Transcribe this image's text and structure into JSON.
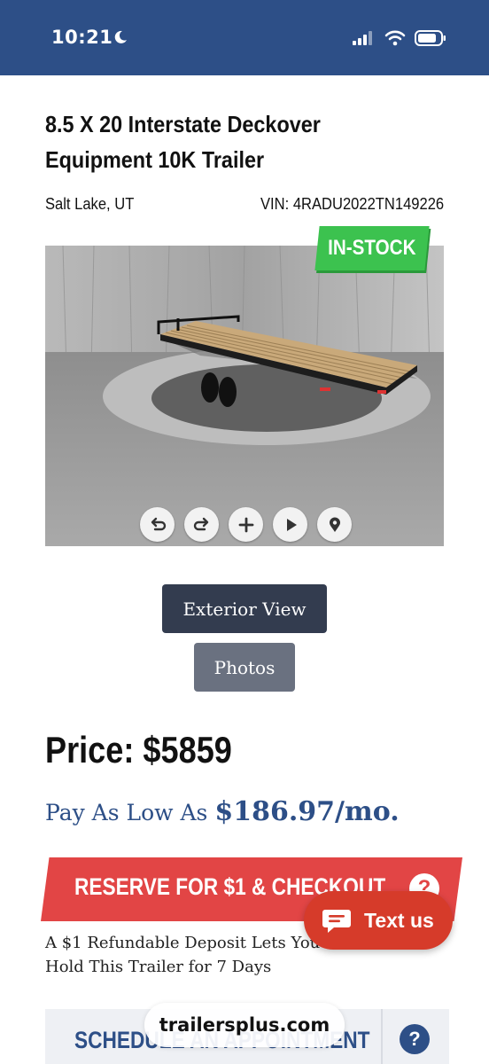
{
  "status_bar": {
    "time": "10:21",
    "icons": [
      "moon-icon",
      "signal-icon",
      "wifi-icon",
      "battery-icon"
    ],
    "color": "#2d4f87"
  },
  "listing": {
    "title": "8.5 X 20 Interstate Deckover Equipment 10K Trailer",
    "location": "Salt Lake, UT",
    "vin": "VIN: 4RADU2022TN149226",
    "stock_badge": "IN-STOCK",
    "stock_badge_color": "#3cc24f"
  },
  "viewer_controls": [
    "rotate-left-icon",
    "rotate-right-icon",
    "zoom-plus-icon",
    "play-icon",
    "location-pin-icon"
  ],
  "view_buttons": {
    "exterior": "Exterior View",
    "photos": "Photos"
  },
  "pricing": {
    "price": "Price: $5859",
    "pay_prefix": "Pay As Low As ",
    "pay_amount": "$186.97/mo."
  },
  "reserve": {
    "label": "RESERVE FOR $1 & CHECKOUT",
    "help": "?",
    "color": "#e24545",
    "note": "A $1 Refundable Deposit Lets You Hold This Trailer for 7 Days"
  },
  "chat": {
    "label": "Text us"
  },
  "schedule": {
    "label": "SCHEDULE AN APPOINTMENT",
    "help": "?"
  },
  "browser": {
    "url": "trailersplus.com"
  }
}
